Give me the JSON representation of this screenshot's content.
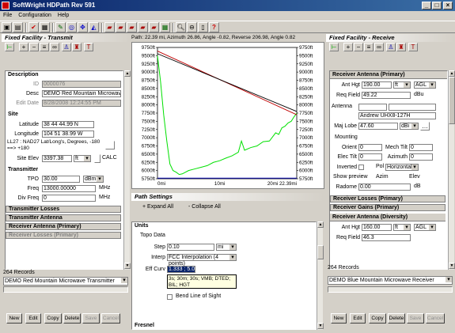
{
  "window": {
    "title": "SoftWright HDPath Rev 591",
    "min": "_",
    "max": "□",
    "close": "×"
  },
  "menu": [
    "File",
    "Configuration",
    "Help"
  ],
  "path_info": "Path: 22.39 mi, Azimuth 26.86, Angle -0.82, Reverse 206.98, Angle 0.82",
  "left": {
    "header": "Fixed Facility - Transmit",
    "description": {
      "section": "Description",
      "id_label": "ID",
      "id": "0000076",
      "desc_label": "Desc",
      "desc": "DEMO Red Mountain Microwave",
      "edit_label": "Edit Date",
      "edit_date": "8/28/2008 12:24:55 PM"
    },
    "site": {
      "section": "Site",
      "lat_label": "Latitude",
      "lat": "38 44 44.99 N",
      "lon_label": "Longitude",
      "lon": "104 51 38.99 W",
      "datum": "LL27 : NAD27 Lat/Long's, Degrees, -180 ==> +180",
      "elev_label": "Site Elev",
      "elev": "3397.38",
      "elev_unit": "ft",
      "calc": "CALC"
    },
    "transmitter": {
      "section": "Transmitter",
      "tpo_label": "TPO",
      "tpo": "30.00",
      "tpo_unit": "dBm",
      "freq_label": "Freq",
      "freq": "13000.00000",
      "freq_unit": "MHz",
      "div_label": "Div Freq",
      "div": "0",
      "div_unit": "MHz"
    },
    "collapsed": [
      "Transmitter Losses",
      "Transmitter Antenna",
      "Receiver Antenna (Primary)",
      "Receiver Losses (Primary)"
    ],
    "records": "264 Records",
    "selected": "DEMO Red Mountain Microwave Transmitter",
    "buttons": [
      "New",
      "Edit",
      "Copy",
      "Delete",
      "Save",
      "Cancel"
    ]
  },
  "right": {
    "header": "Fixed Facility - Receive",
    "rx_antenna": {
      "section": "Receiver Antenna (Primary)",
      "ant_label": "Ant Hgt",
      "ant": "190.00",
      "ant_unit": "ft",
      "ant_ref": "AGL",
      "req_label": "Req Field",
      "req": "49.22",
      "req_unit": "dBu",
      "antenna_label": "Antenna",
      "antenna": "Andrew UHX8-127H",
      "lobe_label": "Maj Lobe",
      "lobe": "47.60",
      "lobe_unit": "dBi",
      "mounting": "Mounting",
      "orient_label": "Orient",
      "orient": "0",
      "mech_label": "Mech Tilt",
      "mech": "0",
      "elec_label": "Elec Tilt",
      "elec": "0",
      "az_label": "Azimuth",
      "az": "0",
      "inv_label": "Inverted",
      "pol_label": "Pol",
      "pol": "Horizontal",
      "preview": "Show preview",
      "azim": "Azim",
      "elev": "Elev",
      "radome_label": "Radome",
      "radome": "0.00",
      "radome_unit": "dB"
    },
    "collapsed": [
      "Receiver Losses (Primary)",
      "Receiver Gains (Primary)"
    ],
    "diversity": {
      "section": "Receiver Antenna (Diversity)",
      "ant_label": "Ant Hgt",
      "ant": "160.00",
      "ant_unit": "ft",
      "ant_ref": "AGL",
      "req_label": "Req Field",
      "req": "46.3"
    },
    "records": "264 Records",
    "selected": "DEMO Blue Mountain Microwave Receiver",
    "buttons": [
      "New",
      "Edit",
      "Copy",
      "Delete",
      "Save",
      "Cancel"
    ]
  },
  "settings": {
    "header": "Path Settings",
    "expand": "+ Expand All",
    "collapse": "- Collapse All",
    "units": "Units",
    "topo": "Topo Data",
    "step_label": "Step",
    "step": "0.10",
    "step_unit": "mi",
    "interp_label": "Interp",
    "interp": "FCC Interpolation (4 points)",
    "eff_label": "Eff Curv",
    "eff": "1.333 ; 5.0",
    "hint": "3s; 30m; 30s; VMB; DTED; BIL; HGT",
    "bend": "Bend Line of Sight",
    "next": "Fresnel"
  },
  "chart_data": {
    "type": "line",
    "y_left_ticks": [
      "9750ft",
      "9500ft",
      "9250ft",
      "9000ft",
      "8750ft",
      "8500ft",
      "8250ft",
      "8000ft",
      "7750ft",
      "7500ft",
      "7250ft",
      "7000ft",
      "6750ft",
      "6500ft",
      "6250ft",
      "6000ft",
      "5750ft"
    ],
    "y_right_ticks": [
      "9750ft",
      "9500ft",
      "9250ft",
      "9000ft",
      "8750ft",
      "8500ft",
      "8250ft",
      "8000ft",
      "7750ft",
      "7500ft",
      "7250ft",
      "7000ft",
      "6750ft",
      "6500ft",
      "6250ft",
      "6000ft",
      "5750ft"
    ],
    "x_ticks": [
      "0mi",
      "10mi",
      "20mi 22.39mi"
    ],
    "ylim": [
      5750,
      9750
    ],
    "xlim": [
      0,
      22.39
    ],
    "series": [
      {
        "color": "#00e000",
        "x": [
          0,
          0.5,
          1,
          1.5,
          2,
          2.5,
          3,
          3.5,
          4,
          5,
          6,
          7,
          8,
          9,
          10,
          11,
          12,
          13,
          13.5,
          14,
          15,
          16,
          17,
          18,
          19,
          19.5,
          20,
          20.5,
          21,
          21.5,
          22,
          22.39
        ],
        "y": [
          9500,
          8700,
          7700,
          6900,
          6200,
          6000,
          5950,
          5880,
          5900,
          6000,
          6050,
          6100,
          6150,
          6250,
          6300,
          6380,
          6450,
          6560,
          6900,
          6620,
          6700,
          6750,
          6880,
          6900,
          7150,
          7100,
          7300,
          7350,
          7450,
          7500,
          7650,
          7750
        ]
      },
      {
        "color": "#c00000",
        "x": [
          0,
          22.39
        ],
        "y": [
          9640,
          7700
        ]
      },
      {
        "color": "#000000",
        "x": [
          0,
          22.39
        ],
        "y": [
          9560,
          7800
        ]
      },
      {
        "color": "#0000c0",
        "x": [
          0,
          22.39
        ],
        "y": [
          5770,
          5770
        ]
      }
    ]
  }
}
